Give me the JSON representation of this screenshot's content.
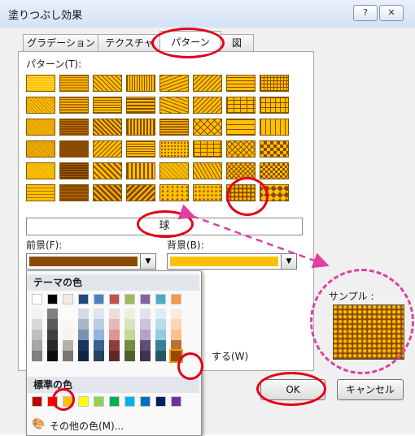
{
  "window": {
    "title": "塗りつぶし効果",
    "help": "?",
    "close": "✕"
  },
  "tabs": [
    {
      "label": "グラデーション"
    },
    {
      "label": "テクスチャ"
    },
    {
      "label": "パターン"
    },
    {
      "label": "図"
    }
  ],
  "pattern_label": "パターン(T):",
  "pattern_name": "球",
  "foreground": {
    "label": "前景(F):",
    "color": "#8b4a00"
  },
  "background": {
    "label": "背景(B):",
    "color": "#ffc000"
  },
  "palette": {
    "theme_title": "テーマの色",
    "standard_title": "標準の色",
    "more_colors": "その他の色(M)...",
    "theme_top": [
      "#ffffff",
      "#000000",
      "#eeece1",
      "#1f497d",
      "#4f81bd",
      "#c0504d",
      "#9bbb59",
      "#8064a2",
      "#4bacc6",
      "#f79646"
    ],
    "standard": [
      "#c00000",
      "#ff0000",
      "#ffc000",
      "#ffff00",
      "#92d050",
      "#00b050",
      "#00b0f0",
      "#0070c0",
      "#002060",
      "#7030a0"
    ]
  },
  "partial_text": "する(W)",
  "sample_label": "サンプル :",
  "buttons": {
    "ok": "OK",
    "cancel": "キャンセル"
  },
  "colors": {
    "accent": "#e2001a",
    "pattern_fg": "#8b4a00",
    "pattern_bg": "#ffc000"
  }
}
